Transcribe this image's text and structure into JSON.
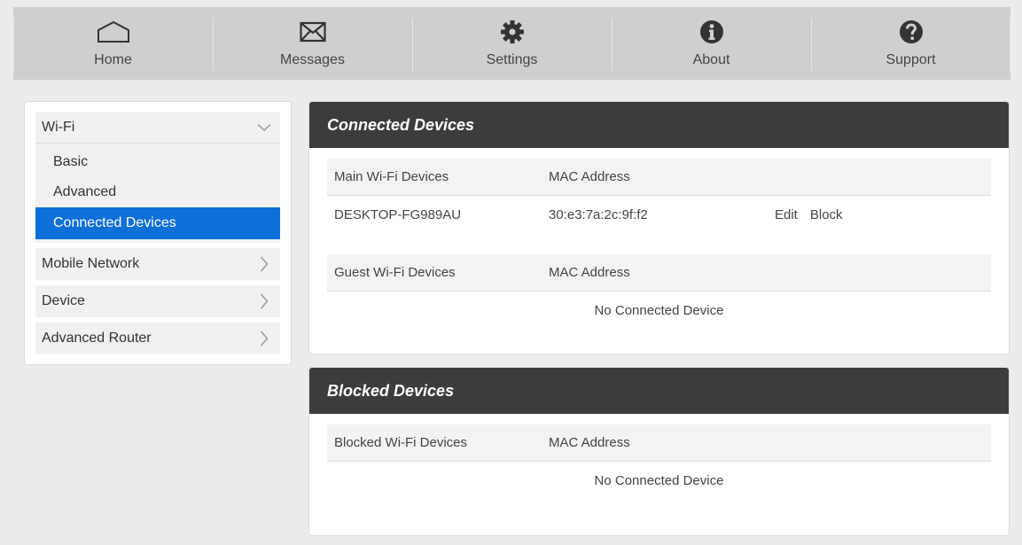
{
  "nav": {
    "home": "Home",
    "messages": "Messages",
    "settings": "Settings",
    "about": "About",
    "support": "Support"
  },
  "sidebar": {
    "wifi": {
      "label": "Wi-Fi",
      "sub": [
        "Basic",
        "Advanced",
        "Connected Devices"
      ]
    },
    "mobile_network": "Mobile Network",
    "device": "Device",
    "advanced_router": "Advanced Router"
  },
  "connected": {
    "title": "Connected Devices",
    "main_header": {
      "col1": "Main Wi-Fi Devices",
      "col2": "MAC Address"
    },
    "main_rows": [
      {
        "name": "DESKTOP-FG989AU",
        "mac": "30:e3:7a:2c:9f:f2",
        "edit": "Edit",
        "block": "Block"
      }
    ],
    "guest_header": {
      "col1": "Guest Wi-Fi Devices",
      "col2": "MAC Address"
    },
    "guest_empty": "No Connected Device"
  },
  "blocked": {
    "title": "Blocked Devices",
    "header": {
      "col1": "Blocked Wi-Fi Devices",
      "col2": "MAC Address"
    },
    "empty": "No Connected Device"
  },
  "colors": {
    "active": "#0d6fd8",
    "panel_header": "#3c3c3c",
    "nav_bg": "#cfcfcf"
  }
}
